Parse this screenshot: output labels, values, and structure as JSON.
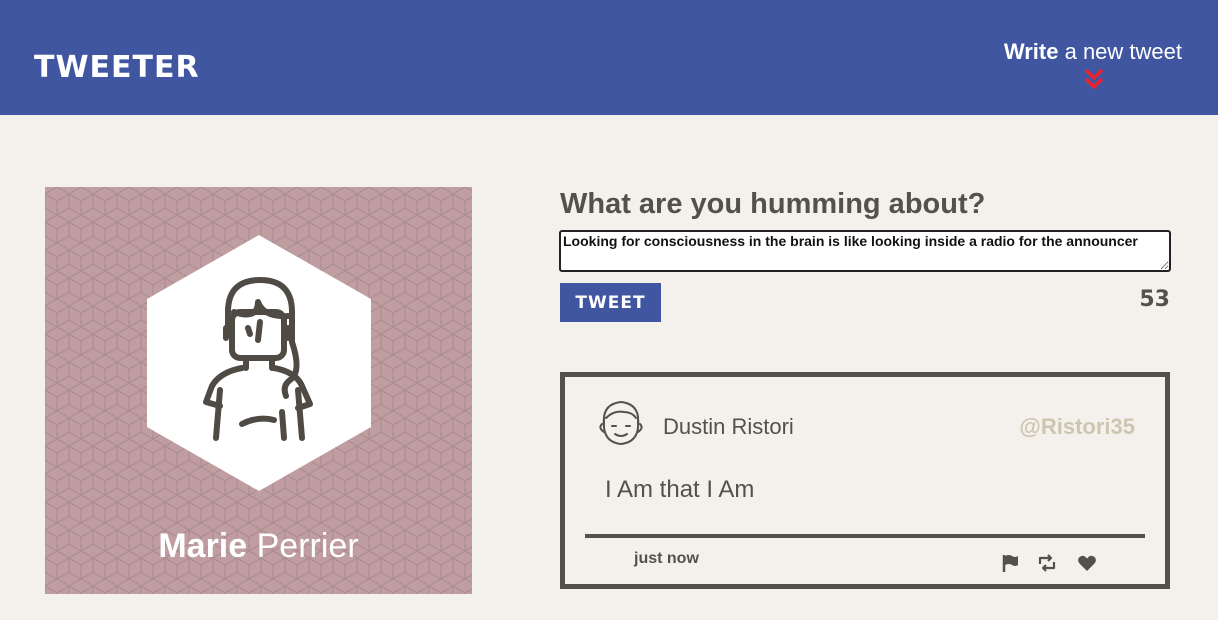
{
  "navbar": {
    "brand": "TWEETER",
    "compose_bold": "Write",
    "compose_rest": " a new tweet",
    "compose_icon": "double-chevron-down-icon",
    "accent_color": "#e8232f",
    "background_color": "#4056a1"
  },
  "profile": {
    "first_name": "Marie",
    "last_name": " Perrier",
    "avatar_icon": "woman-avatar-icon",
    "background_color": "#c09da1"
  },
  "composer": {
    "title": "What are you humming about?",
    "input_value": "Looking for consciousness in the brain is like looking inside a radio for the announcer",
    "button_label": "TWEET",
    "counter": "53"
  },
  "tweets": [
    {
      "author": "Dustin Ristori",
      "handle": "@Ristori35",
      "text": "I Am that I Am",
      "time": "just now",
      "avatar_icon": "man-avatar-icon",
      "actions": [
        "flag-icon",
        "retweet-icon",
        "heart-icon"
      ]
    }
  ]
}
